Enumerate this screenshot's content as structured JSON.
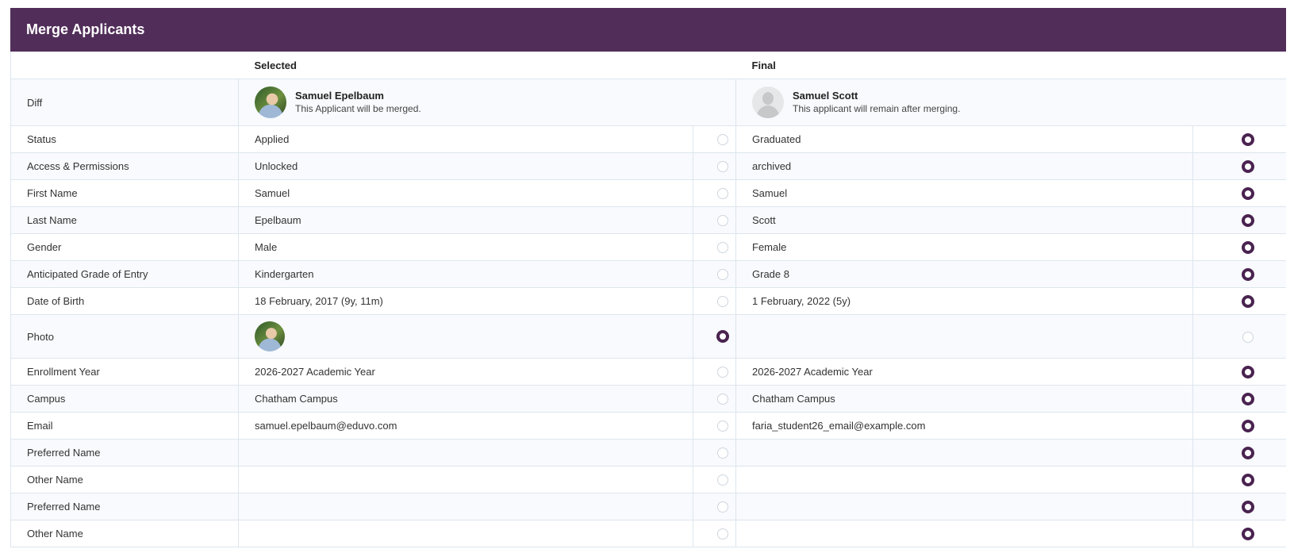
{
  "title": "Merge Applicants",
  "columns": {
    "selected": "Selected",
    "final": "Final"
  },
  "diff": {
    "label": "Diff",
    "selected": {
      "name": "Samuel Epelbaum",
      "note": "This Applicant will be merged.",
      "avatar": "applicant-photo"
    },
    "final": {
      "name": "Samuel Scott",
      "note": "This applicant will remain after merging.",
      "avatar": "person-placeholder-icon"
    }
  },
  "rows": [
    {
      "label": "Status",
      "selected": "Applied",
      "final": "Graduated",
      "choice": "final"
    },
    {
      "label": "Access & Permissions",
      "selected": "Unlocked",
      "final": "archived",
      "choice": "final"
    },
    {
      "label": "First Name",
      "selected": "Samuel",
      "final": "Samuel",
      "choice": "final"
    },
    {
      "label": "Last Name",
      "selected": "Epelbaum",
      "final": "Scott",
      "choice": "final"
    },
    {
      "label": "Gender",
      "selected": "Male",
      "final": "Female",
      "choice": "final"
    },
    {
      "label": "Anticipated Grade of Entry",
      "selected": "Kindergarten",
      "final": "Grade 8",
      "choice": "final"
    },
    {
      "label": "Date of Birth",
      "selected": "18 February, 2017 (9y, 11m)",
      "final": "1 February, 2022 (5y)",
      "choice": "final"
    },
    {
      "label": "Photo",
      "selected": "",
      "final": "",
      "choice": "selected",
      "photo": true
    },
    {
      "label": "Enrollment Year",
      "selected": "2026-2027 Academic Year",
      "final": "2026-2027 Academic Year",
      "choice": "final"
    },
    {
      "label": "Campus",
      "selected": "Chatham Campus",
      "final": "Chatham Campus",
      "choice": "final"
    },
    {
      "label": "Email",
      "selected": "samuel.epelbaum@eduvo.com",
      "final": "faria_student26_email@example.com",
      "choice": "final"
    },
    {
      "label": "Preferred Name",
      "selected": "",
      "final": "",
      "choice": "final"
    },
    {
      "label": "Other Name",
      "selected": "",
      "final": "",
      "choice": "final"
    },
    {
      "label": "Preferred Name",
      "selected": "",
      "final": "",
      "choice": "final"
    },
    {
      "label": "Other Name",
      "selected": "",
      "final": "",
      "choice": "final"
    }
  ],
  "colors": {
    "header": "#512e59",
    "radio_selected": "#4a2350",
    "border": "#dde6ee"
  }
}
